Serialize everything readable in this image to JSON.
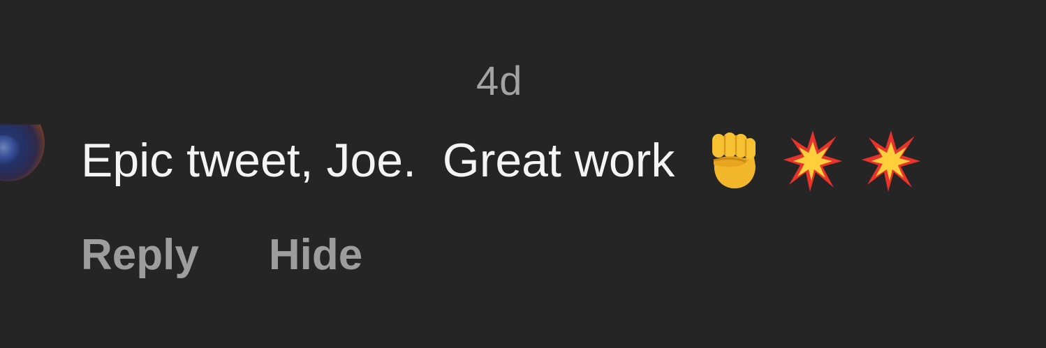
{
  "comment": {
    "timestamp": "4d",
    "text": "Epic tweet, Joe.  Great work",
    "emojis": [
      "fist-emoji",
      "collision-emoji",
      "collision-emoji"
    ]
  },
  "actions": {
    "reply_label": "Reply",
    "hide_label": "Hide"
  },
  "colors": {
    "background": "#252525",
    "text": "#f4f4f4",
    "muted": "#a3a3a3"
  }
}
